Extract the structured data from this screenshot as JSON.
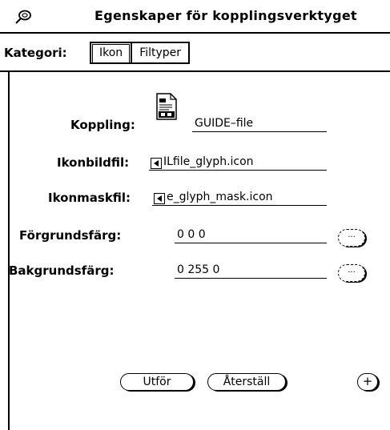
{
  "window": {
    "title": "Egenskaper för kopplingsverktyget"
  },
  "category": {
    "label": "Kategori:",
    "options": [
      {
        "label": "Ikon",
        "selected": true
      },
      {
        "label": "Filtyper",
        "selected": false
      }
    ]
  },
  "form": {
    "binding_label": "Koppling:",
    "binding_value": "GUIDE–file",
    "icon_file_label": "Ikonbildfil:",
    "icon_file_value": "ILfile_glyph.icon",
    "mask_file_label": "Ikonmaskfil:",
    "mask_file_value": "e_glyph_mask.icon",
    "foreground_label": "Förgrundsfärg:",
    "foreground_value": "0 0 0",
    "background_label": "Bakgrundsfärg:",
    "background_value": "0 255 0",
    "color_chooser_label": "..."
  },
  "buttons": {
    "apply": "Utför",
    "reset": "Återställ",
    "plus": "+"
  },
  "icons": {
    "pin": "pushpin-icon",
    "binding_icon": "document-glyph-icon",
    "scroll": "scroll-left-arrow-icon"
  }
}
